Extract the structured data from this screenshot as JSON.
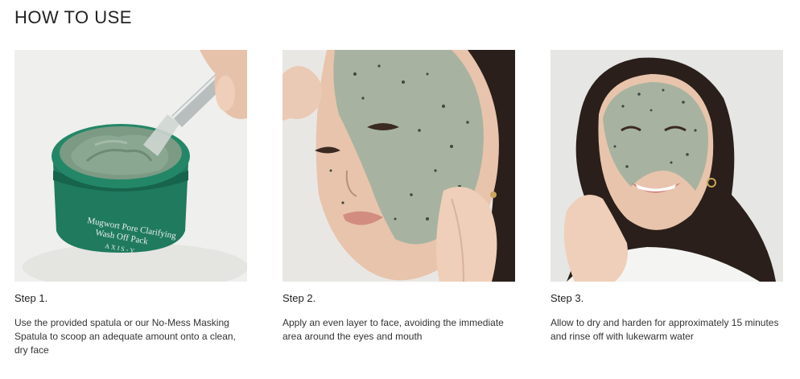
{
  "page": {
    "title": "HOW TO USE"
  },
  "product": {
    "jar_label_line1": "Mugwort Pore Clarifying",
    "jar_label_line2": "Wash Off Pack",
    "jar_brand": "AXIS-Y"
  },
  "steps": [
    {
      "label": "Step 1.",
      "description": "Use the provided spatula or our No-Mess Masking Spatula to scoop an adequate amount onto a clean, dry face",
      "image_icon": "spatula-scooping-jar-image"
    },
    {
      "label": "Step 2.",
      "description": "Apply an even layer to face, avoiding the immediate area around the eyes and mouth",
      "image_icon": "applying-mask-image"
    },
    {
      "label": "Step 3.",
      "description": "Allow to dry and harden for approximately 15 minutes and rinse off with lukewarm water",
      "image_icon": "smiling-with-mask-image"
    }
  ],
  "colors": {
    "jar_green": "#1f7a5e",
    "mask_green": "#8fa894",
    "skin": "#e8c4ac",
    "hair": "#2a1f1a",
    "background_photo": "#ececea"
  }
}
